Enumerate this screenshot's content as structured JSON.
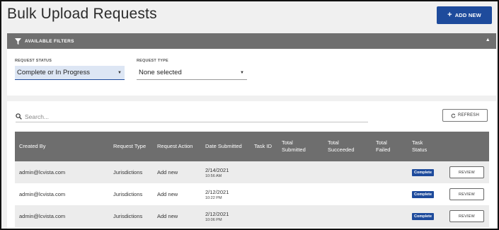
{
  "page": {
    "title": "Bulk Upload Requests",
    "add_new_label": "ADD NEW"
  },
  "filters": {
    "header": "AVAILABLE FILTERS",
    "request_status": {
      "label": "REQUEST STATUS",
      "value": "Complete or In Progress"
    },
    "request_type": {
      "label": "REQUEST TYPE",
      "value": "None selected"
    }
  },
  "search": {
    "placeholder": "Search..."
  },
  "refresh_label": "REFRESH",
  "table": {
    "headers": {
      "created_by": "Created By",
      "request_type": "Request Type",
      "request_action": "Request Action",
      "date_submitted": "Date Submitted",
      "task_id": "Task ID",
      "total_submitted_1": "Total",
      "total_submitted_2": "Submitted",
      "total_succeeded_1": "Total",
      "total_succeeded_2": "Succeeded",
      "total_failed_1": "Total",
      "total_failed_2": "Failed",
      "task_status_1": "Task",
      "task_status_2": "Status"
    },
    "rows": [
      {
        "created_by": "admin@lcvista.com",
        "request_type": "Jurisdictions",
        "request_action": "Add new",
        "date": "2/14/2021",
        "time": "10:56 AM",
        "status": "Complete",
        "review": "REVIEW"
      },
      {
        "created_by": "admin@lcvista.com",
        "request_type": "Jurisdictions",
        "request_action": "Add new",
        "date": "2/12/2021",
        "time": "10:22 PM",
        "status": "Complete",
        "review": "REVIEW"
      },
      {
        "created_by": "admin@lcvista.com",
        "request_type": "Jurisdictions",
        "request_action": "Add new",
        "date": "2/12/2021",
        "time": "10:06 PM",
        "status": "Complete",
        "review": "REVIEW"
      }
    ]
  },
  "colors": {
    "primary": "#1e4b9c",
    "header_gray": "#6f6f6f",
    "page_bg": "#f0f0f0"
  }
}
